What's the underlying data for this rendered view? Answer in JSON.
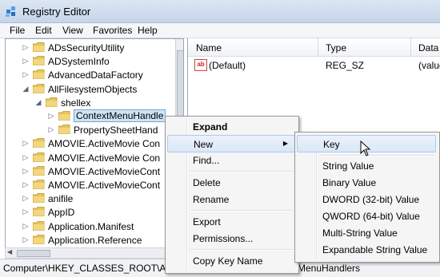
{
  "window": {
    "title": "Registry Editor"
  },
  "menu": [
    "File",
    "Edit",
    "View",
    "Favorites",
    "Help"
  ],
  "tree": {
    "items": [
      {
        "label": "ADsSecurityUtility",
        "level": 0,
        "arrow": "▷"
      },
      {
        "label": "ADSystemInfo",
        "level": 0,
        "arrow": "▷"
      },
      {
        "label": "AdvancedDataFactory",
        "level": 0,
        "arrow": "▷"
      },
      {
        "label": "AllFilesystemObjects",
        "level": 0,
        "arrow": "◢"
      },
      {
        "label": "shellex",
        "level": 1,
        "arrow": "◢"
      },
      {
        "label": "ContextMenuHandle",
        "level": 2,
        "arrow": "▷",
        "selected": true
      },
      {
        "label": "PropertySheetHand",
        "level": 2,
        "arrow": "▷"
      },
      {
        "label": "AMOVIE.ActiveMovie Con",
        "level": 0,
        "arrow": "▷"
      },
      {
        "label": "AMOVIE.ActiveMovie Con",
        "level": 0,
        "arrow": "▷"
      },
      {
        "label": "AMOVIE.ActiveMovieCont",
        "level": 0,
        "arrow": "▷"
      },
      {
        "label": "AMOVIE.ActiveMovieCont",
        "level": 0,
        "arrow": "▷"
      },
      {
        "label": "anifile",
        "level": 0,
        "arrow": "▷"
      },
      {
        "label": "AppID",
        "level": 0,
        "arrow": "▷"
      },
      {
        "label": "Application.Manifest",
        "level": 0,
        "arrow": "▷"
      },
      {
        "label": "Application.Reference",
        "level": 0,
        "arrow": "▷"
      }
    ],
    "scroll_left": "◀",
    "scroll_right": "▶"
  },
  "list": {
    "columns": [
      "Name",
      "Type",
      "Data"
    ],
    "rows": [
      {
        "icon": "ab",
        "name": "(Default)",
        "type": "REG_SZ",
        "data": "(value"
      }
    ]
  },
  "status": {
    "left": "Computer\\HKEY_CLASSES_ROOT\\AllFil",
    "right": "MenuHandlers"
  },
  "context_menu": {
    "items": [
      "Expand",
      "New",
      "Find...",
      "Delete",
      "Rename",
      "Export",
      "Permissions...",
      "Copy Key Name"
    ],
    "submenu_arrow": "▶"
  },
  "new_submenu": {
    "items": [
      "Key",
      "String Value",
      "Binary Value",
      "DWORD (32-bit) Value",
      "QWORD (64-bit) Value",
      "Multi-String Value",
      "Expandable String Value"
    ]
  },
  "colors": {
    "folder": "#e8c45a",
    "selection": "#cde4f7",
    "menu_hover": "#dbe8f8"
  }
}
